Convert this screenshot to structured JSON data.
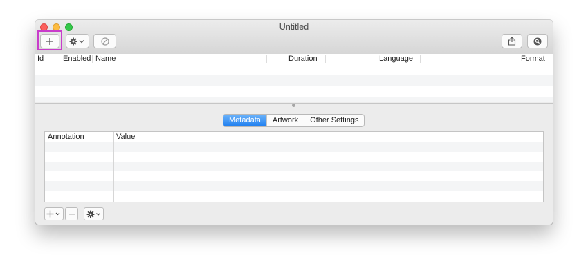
{
  "window": {
    "title": "Untitled"
  },
  "toolbar": {
    "add_icon": "plus-icon",
    "action_icon": "gear-icon",
    "disable_icon": "prohibited-icon",
    "share_icon": "share-icon",
    "search_icon": "search-icon",
    "highlight_color": "#c93ccb"
  },
  "tracks_table": {
    "columns": [
      "Id",
      "Enabled",
      "Name",
      "Duration",
      "Language",
      "Format"
    ],
    "rows": []
  },
  "tabs": {
    "items": [
      "Metadata",
      "Artwork",
      "Other Settings"
    ],
    "active": "Metadata",
    "active_color": "#1e7ef0"
  },
  "metadata_table": {
    "columns": [
      "Annotation",
      "Value"
    ],
    "rows": []
  },
  "footer": {
    "add_icon": "plus-icon",
    "remove_icon": "minus-icon",
    "action_icon": "gear-icon"
  }
}
